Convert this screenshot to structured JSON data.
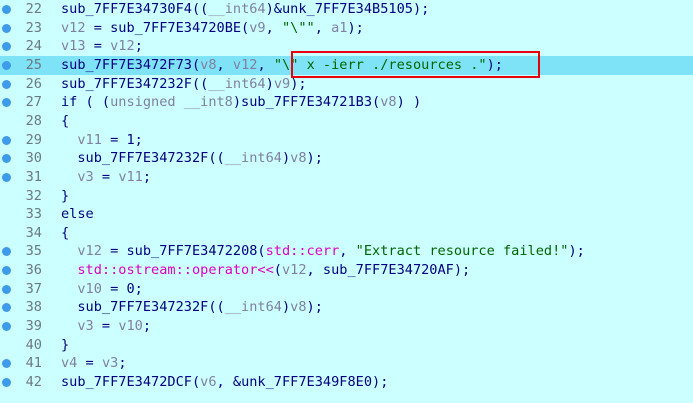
{
  "lines": [
    {
      "num": "22",
      "dot": true,
      "parts": [
        [
          "f",
          "sub_7FF7E34730F4(("
        ],
        [
          "v",
          "__int64"
        ],
        [
          "f",
          ")&unk_7FF7E34B5105);"
        ]
      ]
    },
    {
      "num": "23",
      "dot": true,
      "parts": [
        [
          "v",
          "v12"
        ],
        [
          "f",
          " = sub_7FF7E34720BE("
        ],
        [
          "v",
          "v9"
        ],
        [
          "f",
          ", "
        ],
        [
          "s",
          "\"\\\"\""
        ],
        [
          "f",
          ", "
        ],
        [
          "v",
          "a1"
        ],
        [
          "f",
          ");"
        ]
      ]
    },
    {
      "num": "24",
      "dot": true,
      "parts": [
        [
          "v",
          "v13"
        ],
        [
          "f",
          " = "
        ],
        [
          "v",
          "v12"
        ],
        [
          "f",
          ";"
        ]
      ]
    },
    {
      "num": "25",
      "dot": true,
      "hl": true,
      "parts": [
        [
          "f",
          "sub_7FF7E3472F73("
        ],
        [
          "v",
          "v8"
        ],
        [
          "f",
          ", "
        ],
        [
          "v",
          "v12"
        ],
        [
          "f",
          ", "
        ],
        [
          "s",
          "\"\\\" x -ierr ./resources .\""
        ],
        [
          "f",
          ");"
        ]
      ]
    },
    {
      "num": "26",
      "dot": true,
      "parts": [
        [
          "f",
          "sub_7FF7E347232F(("
        ],
        [
          "v",
          "__int64"
        ],
        [
          "f",
          ")"
        ],
        [
          "v",
          "v9"
        ],
        [
          "f",
          ");"
        ]
      ]
    },
    {
      "num": "27",
      "dot": true,
      "parts": [
        [
          "f",
          "if ( ("
        ],
        [
          "v",
          "unsigned __int8"
        ],
        [
          "f",
          ")sub_7FF7E34721B3("
        ],
        [
          "v",
          "v8"
        ],
        [
          "f",
          ") )"
        ]
      ]
    },
    {
      "num": "28",
      "dot": false,
      "parts": [
        [
          "f",
          "{"
        ]
      ]
    },
    {
      "num": "29",
      "dot": true,
      "parts": [
        [
          "f",
          "  "
        ],
        [
          "v",
          "v11"
        ],
        [
          "f",
          " = 1;"
        ]
      ]
    },
    {
      "num": "30",
      "dot": true,
      "parts": [
        [
          "f",
          "  sub_7FF7E347232F(("
        ],
        [
          "v",
          "__int64"
        ],
        [
          "f",
          ")"
        ],
        [
          "v",
          "v8"
        ],
        [
          "f",
          ");"
        ]
      ]
    },
    {
      "num": "31",
      "dot": true,
      "parts": [
        [
          "f",
          "  "
        ],
        [
          "v",
          "v3"
        ],
        [
          "f",
          " = "
        ],
        [
          "v",
          "v11"
        ],
        [
          "f",
          ";"
        ]
      ]
    },
    {
      "num": "32",
      "dot": false,
      "parts": [
        [
          "f",
          "}"
        ]
      ]
    },
    {
      "num": "33",
      "dot": false,
      "parts": [
        [
          "f",
          "else"
        ]
      ]
    },
    {
      "num": "34",
      "dot": false,
      "parts": [
        [
          "f",
          "{"
        ]
      ]
    },
    {
      "num": "35",
      "dot": true,
      "parts": [
        [
          "f",
          "  "
        ],
        [
          "v",
          "v12"
        ],
        [
          "f",
          " = sub_7FF7E3472208("
        ],
        [
          "p",
          "std::cerr"
        ],
        [
          "f",
          ", "
        ],
        [
          "s",
          "\"Extract resource failed!\""
        ],
        [
          "f",
          ");"
        ]
      ]
    },
    {
      "num": "36",
      "dot": true,
      "parts": [
        [
          "f",
          "  "
        ],
        [
          "p",
          "std::ostream::operator<<"
        ],
        [
          "f",
          "("
        ],
        [
          "v",
          "v12"
        ],
        [
          "f",
          ", sub_7FF7E34720AF);"
        ]
      ]
    },
    {
      "num": "37",
      "dot": true,
      "parts": [
        [
          "f",
          "  "
        ],
        [
          "v",
          "v10"
        ],
        [
          "f",
          " = 0;"
        ]
      ]
    },
    {
      "num": "38",
      "dot": true,
      "parts": [
        [
          "f",
          "  sub_7FF7E347232F(("
        ],
        [
          "v",
          "__int64"
        ],
        [
          "f",
          ")"
        ],
        [
          "v",
          "v8"
        ],
        [
          "f",
          ");"
        ]
      ]
    },
    {
      "num": "39",
      "dot": true,
      "parts": [
        [
          "f",
          "  "
        ],
        [
          "v",
          "v3"
        ],
        [
          "f",
          " = "
        ],
        [
          "v",
          "v10"
        ],
        [
          "f",
          ";"
        ]
      ]
    },
    {
      "num": "40",
      "dot": false,
      "parts": [
        [
          "f",
          "}"
        ]
      ]
    },
    {
      "num": "41",
      "dot": true,
      "parts": [
        [
          "v",
          "v4"
        ],
        [
          "f",
          " = "
        ],
        [
          "v",
          "v3"
        ],
        [
          "f",
          ";"
        ]
      ]
    },
    {
      "num": "42",
      "dot": true,
      "parts": [
        [
          "f",
          "sub_7FF7E3472DCF("
        ],
        [
          "v",
          "v6"
        ],
        [
          "f",
          ", &unk_7FF7E349F8E0);"
        ]
      ]
    }
  ],
  "colors": {
    "background": "#ccffff",
    "highlight": "#7fe3f7",
    "breakpoint_dot": "#3d9be9",
    "annotation_box": "#e8000f"
  }
}
